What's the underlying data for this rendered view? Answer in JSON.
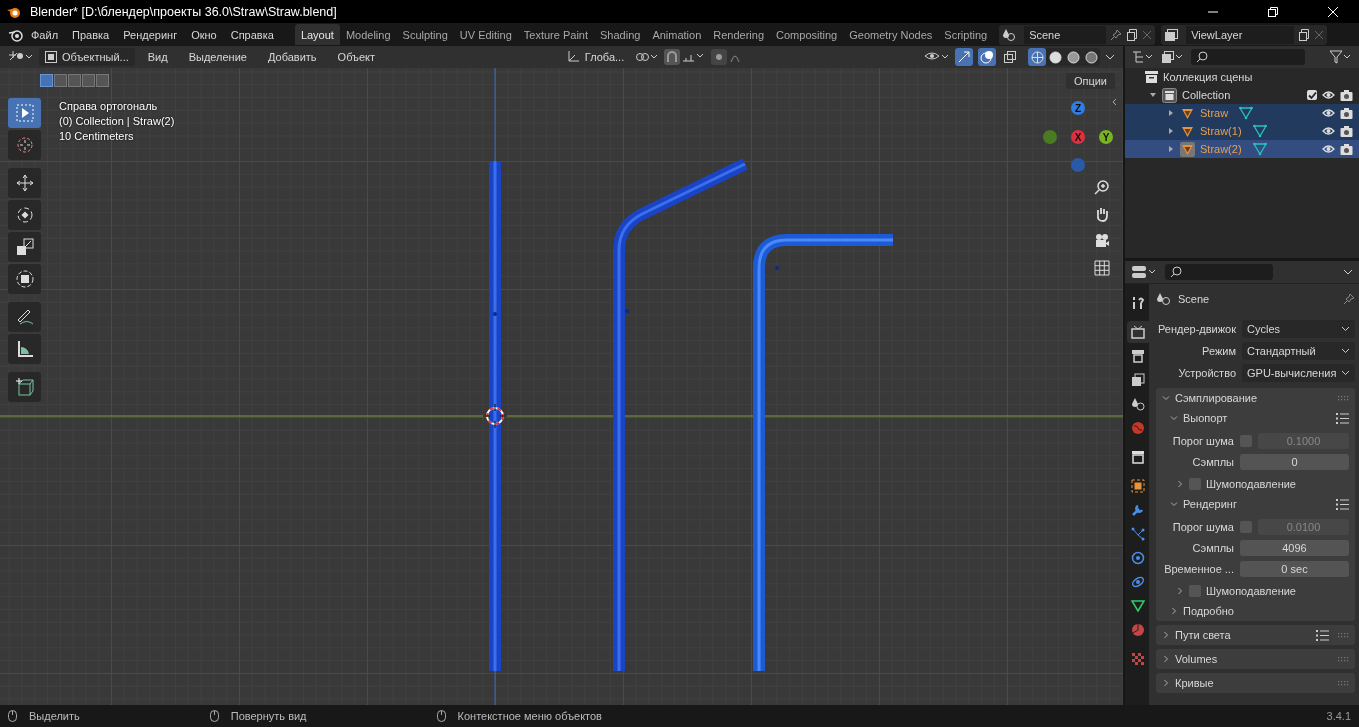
{
  "window": {
    "title": "Blender* [D:\\блендер\\проекты 36.0\\Straw\\Straw.blend]"
  },
  "menu": [
    "Файл",
    "Правка",
    "Рендеринг",
    "Окно",
    "Справка"
  ],
  "workspaces": [
    {
      "label": "Layout",
      "selected": true
    },
    {
      "label": "Modeling",
      "selected": false
    },
    {
      "label": "Sculpting",
      "selected": false
    },
    {
      "label": "UV Editing",
      "selected": false
    },
    {
      "label": "Texture Paint",
      "selected": false
    },
    {
      "label": "Shading",
      "selected": false
    },
    {
      "label": "Animation",
      "selected": false
    },
    {
      "label": "Rendering",
      "selected": false
    },
    {
      "label": "Compositing",
      "selected": false
    },
    {
      "label": "Geometry Nodes",
      "selected": false
    },
    {
      "label": "Scripting",
      "selected": false
    }
  ],
  "scene": "Scene",
  "view_layer": "ViewLayer",
  "viewport": {
    "mode": "Объектный...",
    "menus": [
      "Вид",
      "Выделение",
      "Добавить",
      "Объект"
    ],
    "orientation": "Глоба...",
    "toggles": [
      {
        "kind": "gizmo",
        "on": true
      },
      {
        "kind": "overlay",
        "on": true
      },
      {
        "kind": "xray",
        "on": false
      }
    ],
    "shading": [
      {
        "kind": "wireframe",
        "selected": true
      },
      {
        "kind": "solid",
        "selected": false
      },
      {
        "kind": "material",
        "selected": false
      },
      {
        "kind": "rendered",
        "selected": false
      }
    ],
    "select_modes": [
      {
        "selected": true
      },
      {
        "selected": false
      },
      {
        "selected": false
      },
      {
        "selected": false
      },
      {
        "selected": false
      }
    ],
    "options": "Опции",
    "info": [
      "Справа ортогональ",
      "(0) Collection | Straw(2)",
      "10 Centimeters"
    ],
    "tools": [
      {
        "kind": "select",
        "selected": true
      },
      {
        "kind": "cursor",
        "selected": false
      },
      {
        "kind": "move",
        "selected": false
      },
      {
        "kind": "rotate",
        "selected": false
      },
      {
        "kind": "scale",
        "selected": false
      },
      {
        "kind": "transform",
        "selected": false
      },
      {
        "kind": "annotate",
        "selected": false
      },
      {
        "kind": "measure",
        "selected": false
      },
      {
        "kind": "add-cube",
        "selected": false
      }
    ],
    "axes": [
      {
        "label": "Z",
        "kind": "z"
      },
      {
        "label": "X",
        "kind": "x"
      },
      {
        "label": "Y",
        "kind": "y"
      }
    ]
  },
  "outliner": {
    "root": "Коллекция сцены",
    "tree": [
      {
        "label": "Collection",
        "expanded": true,
        "checked": true,
        "children": [
          {
            "label": "Straw",
            "selected": true,
            "active": false
          },
          {
            "label": "Straw(1)",
            "selected": true,
            "active": false
          },
          {
            "label": "Straw(2)",
            "selected": true,
            "active": true
          }
        ]
      }
    ]
  },
  "properties": {
    "tabs": [
      {
        "kind": "tool",
        "selected": false
      },
      {
        "kind": "render",
        "selected": true
      },
      {
        "kind": "output",
        "selected": false
      },
      {
        "kind": "view",
        "selected": false
      },
      {
        "kind": "scene",
        "selected": false
      },
      {
        "kind": "world",
        "selected": false
      },
      {
        "kind": "collection",
        "selected": false
      },
      {
        "kind": "object",
        "selected": false
      },
      {
        "kind": "modifier",
        "selected": false
      },
      {
        "kind": "particles",
        "selected": false
      },
      {
        "kind": "physics",
        "selected": false
      },
      {
        "kind": "constraint",
        "selected": false
      },
      {
        "kind": "data",
        "selected": false
      },
      {
        "kind": "material",
        "selected": false
      },
      {
        "kind": "texture",
        "selected": false
      }
    ],
    "context": "Scene",
    "fields": [
      {
        "label": "Рендер-движок",
        "value": "Cycles"
      },
      {
        "label": "Режим",
        "value": "Стандартный"
      },
      {
        "label": "Устройство",
        "value": "GPU-вычисления"
      }
    ],
    "panels": [
      {
        "title": "Сэмплирование",
        "expanded": true,
        "presets": false,
        "children": [
          {
            "title": "Выопорт",
            "expanded": true,
            "presets": true,
            "rows": [
              {
                "label": "Порог шума",
                "kind": "threshold",
                "checked": false,
                "value": "0.1000"
              },
              {
                "label": "Сэмплы",
                "kind": "number",
                "value": "0"
              }
            ],
            "children": [
              {
                "title": "Шумоподавление",
                "expanded": false,
                "checked": false
              }
            ]
          },
          {
            "title": "Рендеринг",
            "expanded": true,
            "presets": true,
            "rows": [
              {
                "label": "Порог шума",
                "kind": "threshold",
                "checked": false,
                "value": "0.0100"
              },
              {
                "label": "Сэмплы",
                "kind": "number",
                "value": "4096"
              },
              {
                "label": "Временное ...",
                "kind": "number",
                "value": "0 sec"
              }
            ],
            "children": [
              {
                "title": "Шумоподавление",
                "expanded": false,
                "checked": false
              }
            ]
          },
          {
            "title": "Подробно",
            "expanded": false
          }
        ]
      },
      {
        "title": "Пути света",
        "expanded": false,
        "presets": true
      },
      {
        "title": "Volumes",
        "expanded": false
      },
      {
        "title": "Кривые",
        "expanded": false
      }
    ]
  },
  "status_bar": {
    "hints": [
      "Выделить",
      "Повернуть вид",
      "Контекстное меню объектов"
    ],
    "version": "3.4.1"
  }
}
